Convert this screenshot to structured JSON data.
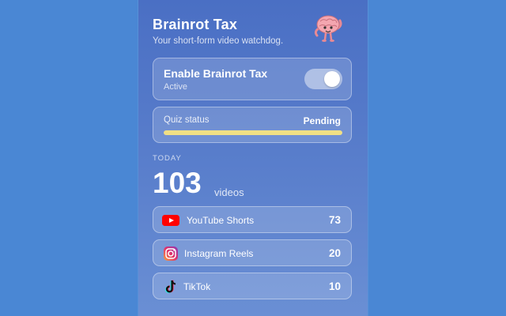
{
  "header": {
    "title": "Brainrot Tax",
    "subtitle": "Your short-form video watchdog.",
    "mascot_icon": "brain-mascot-icon"
  },
  "enable": {
    "title": "Enable Brainrot Tax",
    "status": "Active",
    "toggle_on": true
  },
  "quiz": {
    "label": "Quiz status",
    "value": "Pending",
    "progress": 1.0,
    "bar_color": "#f0df84"
  },
  "today": {
    "label": "TODAY",
    "count": "103",
    "unit": "videos"
  },
  "platforms": [
    {
      "name": "YouTube Shorts",
      "count": "73",
      "icon": "youtube-icon"
    },
    {
      "name": "Instagram Reels",
      "count": "20",
      "icon": "instagram-icon"
    },
    {
      "name": "TikTok",
      "count": "10",
      "icon": "tiktok-icon"
    }
  ]
}
